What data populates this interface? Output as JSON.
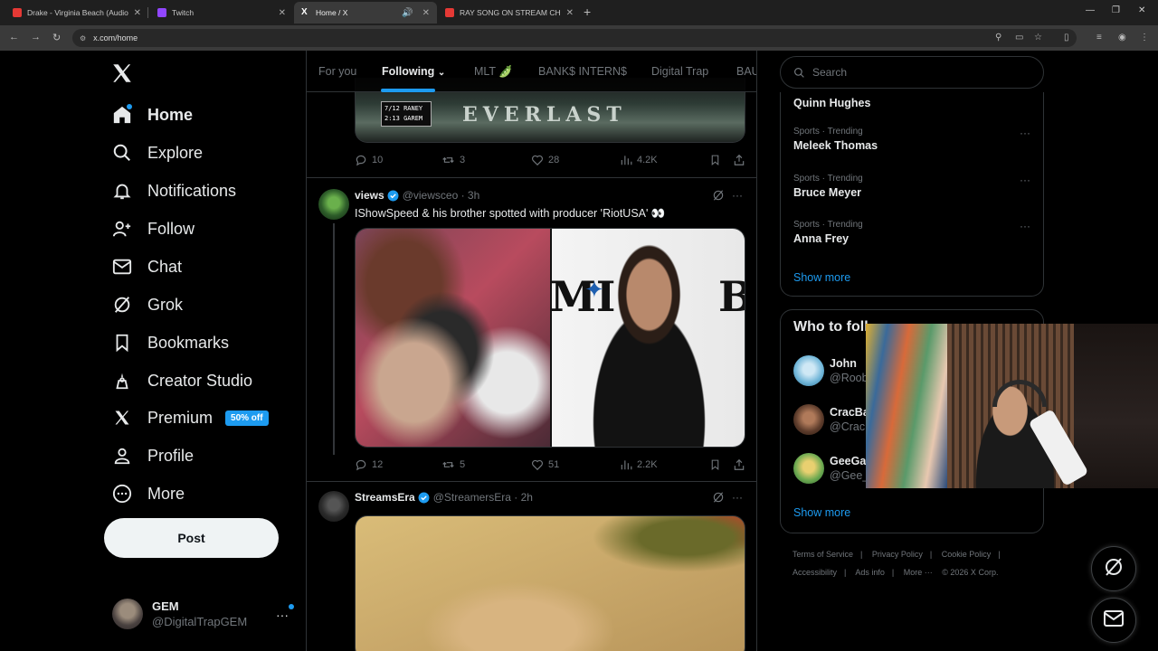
{
  "browser": {
    "tabs": [
      {
        "title": "Drake - Virginia Beach (Audio)",
        "favicon_color": "#e53935"
      },
      {
        "title": "Twitch",
        "favicon_color": "#9146ff"
      },
      {
        "title": "Home / X",
        "favicon_color": "#ffffff"
      },
      {
        "title": "RAY SONG ON STREAM CHRIS...",
        "favicon_color": "#e53935"
      }
    ],
    "url": "x.com/home"
  },
  "sidebar": {
    "items": [
      {
        "label": "Home",
        "icon": "home-icon"
      },
      {
        "label": "Explore",
        "icon": "search-icon"
      },
      {
        "label": "Notifications",
        "icon": "bell-icon"
      },
      {
        "label": "Follow",
        "icon": "follow-icon"
      },
      {
        "label": "Chat",
        "icon": "mail-icon"
      },
      {
        "label": "Grok",
        "icon": "grok-icon"
      },
      {
        "label": "Bookmarks",
        "icon": "bookmark-icon"
      },
      {
        "label": "Creator Studio",
        "icon": "creator-studio-icon"
      },
      {
        "label": "Premium",
        "icon": "x-logo-icon",
        "badge": "50% off"
      },
      {
        "label": "Profile",
        "icon": "person-icon"
      },
      {
        "label": "More",
        "icon": "more-circle-icon"
      }
    ],
    "post_label": "Post",
    "account": {
      "name": "GEM",
      "handle": "@DigitalTrapGEM"
    }
  },
  "feed": {
    "tabs": [
      "For you",
      "Following",
      "MLT 🫛",
      "BANK$ INTERN$",
      "Digital Trap",
      "BAU"
    ],
    "prev_tweet": {
      "replies": "10",
      "reposts": "3",
      "likes": "28",
      "views": "4.2K",
      "image_text": "EVERLAST",
      "score_lines": [
        "7/12  RANEY",
        "2:13  GAREM"
      ]
    },
    "tweet1": {
      "name": "views",
      "handle": "@viewsceo",
      "time": "· 3h",
      "text": "IShowSpeed & his brother spotted with producer 'RiotUSA' 👀",
      "replies": "12",
      "reposts": "5",
      "likes": "51",
      "views": "2.2K"
    },
    "tweet2": {
      "name": "StreamsEra",
      "handle": "@StreamersEra",
      "time": "· 2h"
    }
  },
  "right": {
    "search_placeholder": "Search",
    "trends": [
      {
        "category": "",
        "name": "Quinn Hughes"
      },
      {
        "category": "Sports · Trending",
        "name": "Meleek Thomas"
      },
      {
        "category": "Sports · Trending",
        "name": "Bruce Meyer"
      },
      {
        "category": "Sports · Trending",
        "name": "Anna Frey"
      }
    ],
    "show_more": "Show more",
    "who_to_follow": {
      "title": "Who to foll",
      "users": [
        {
          "name": "John",
          "handle": "@Roob"
        },
        {
          "name": "CracBa",
          "handle": "@Crac"
        },
        {
          "name": "GeeGa",
          "handle": "@Gee_"
        }
      ],
      "show_more": "Show more"
    },
    "footer": [
      "Terms of Service",
      "|",
      "Privacy Policy",
      "|",
      "Cookie Policy",
      "|",
      "Accessibility",
      "|",
      "Ads info",
      "|",
      "More ···",
      "© 2026 X Corp."
    ]
  },
  "colors": {
    "accent": "#1d9bf0",
    "background": "#000000",
    "border": "#2f3336",
    "muted": "#71767b"
  }
}
